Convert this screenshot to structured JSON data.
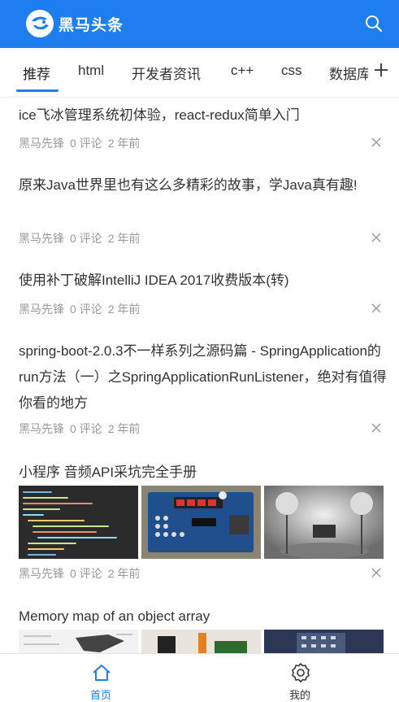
{
  "app": {
    "title": "黑马头条"
  },
  "header": {
    "search_icon": "search-icon"
  },
  "tabs": [
    {
      "label": "推荐",
      "active": true
    },
    {
      "label": "html"
    },
    {
      "label": "开发者资讯"
    },
    {
      "label": "c++"
    },
    {
      "label": "css"
    },
    {
      "label": "数据库"
    }
  ],
  "tab_add_icon": "plus-icon",
  "articles": [
    {
      "title": "ice飞冰管理系统初体验，react-redux简单入门",
      "author": "黑马先锋",
      "comments": "0 评论",
      "time": "2 年前"
    },
    {
      "title": "原来Java世界里也有这么多精彩的故事，学Java真有趣!",
      "author": "黑马先锋",
      "comments": "0 评论",
      "time": "2 年前"
    },
    {
      "title": "使用补丁破解IntelliJ IDEA 2017收费版本(转)",
      "author": "黑马先锋",
      "comments": "0 评论",
      "time": "2 年前"
    },
    {
      "title": "spring-boot-2.0.3不一样系列之源码篇 - SpringApplication的run方法（一）之SpringApplicationRunListener，绝对有值得你看的地方",
      "author": "黑马先锋",
      "comments": "0 评论",
      "time": "2 年前"
    },
    {
      "title": "小程序 音频API采坑完全手册",
      "author": "黑马先锋",
      "comments": "0 评论",
      "time": "2 年前"
    },
    {
      "title": "Memory map of an object array"
    }
  ],
  "tabbar": [
    {
      "label": "首页",
      "icon": "home-icon",
      "active": true,
      "color": "#1e7ef0"
    },
    {
      "label": "我的",
      "icon": "settings-icon",
      "active": false,
      "color": "#333333"
    }
  ],
  "colors": {
    "brand": "#1e7ef0",
    "meta": "#999999"
  }
}
